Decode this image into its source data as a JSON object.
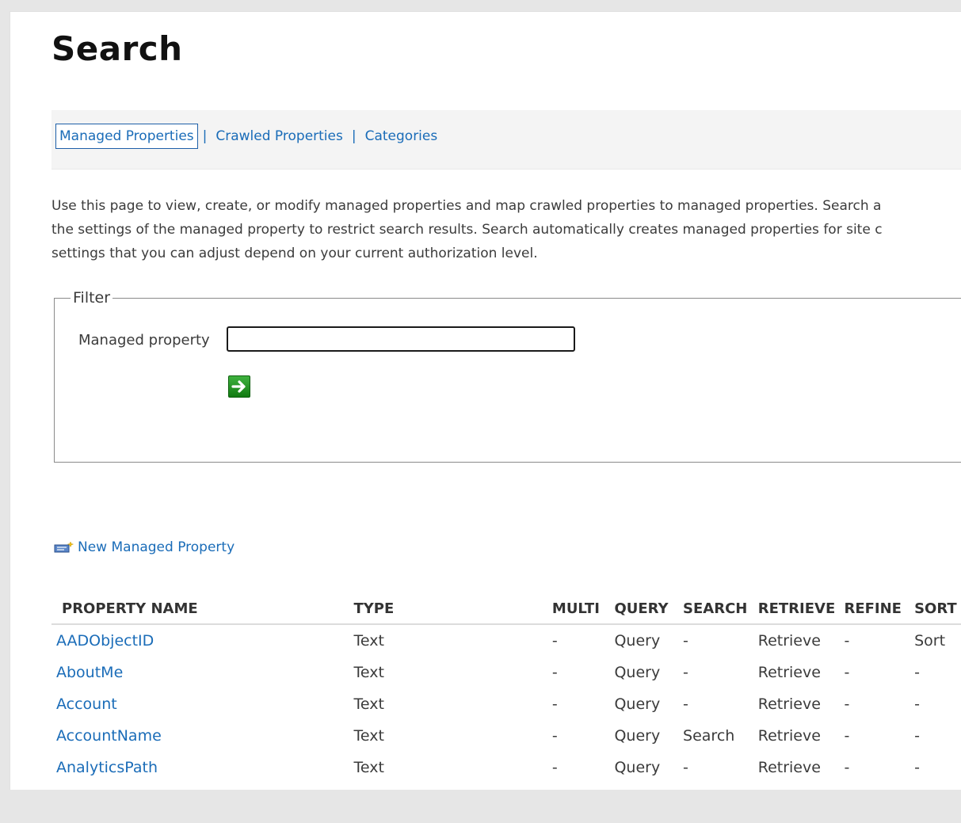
{
  "page": {
    "title": "Search"
  },
  "nav": {
    "links": [
      {
        "label": "Managed Properties",
        "active": true
      },
      {
        "label": "Crawled Properties",
        "active": false
      },
      {
        "label": "Categories",
        "active": false
      }
    ],
    "separator": "|"
  },
  "description": {
    "line1": "Use this page to view, create, or modify managed properties and map crawled properties to managed properties. Search a",
    "line2": "the settings of the managed property to restrict search results. Search automatically creates managed properties for site c",
    "line3": "settings that you can adjust depend on your current authorization level."
  },
  "filter": {
    "legend": "Filter",
    "label": "Managed property",
    "input_value": "",
    "go_icon": "arrow-right-icon"
  },
  "new_property": {
    "label": "New Managed Property",
    "icon": "new-property-icon"
  },
  "table": {
    "columns": [
      "PROPERTY NAME",
      "TYPE",
      "MULTI",
      "QUERY",
      "SEARCH",
      "RETRIEVE",
      "REFINE",
      "SORT"
    ],
    "rows": [
      {
        "name": "AADObjectID",
        "type": "Text",
        "multi": "-",
        "query": "Query",
        "search": "-",
        "retrieve": "Retrieve",
        "refine": "-",
        "sort": "Sort"
      },
      {
        "name": "AboutMe",
        "type": "Text",
        "multi": "-",
        "query": "Query",
        "search": "-",
        "retrieve": "Retrieve",
        "refine": "-",
        "sort": "-"
      },
      {
        "name": "Account",
        "type": "Text",
        "multi": "-",
        "query": "Query",
        "search": "-",
        "retrieve": "Retrieve",
        "refine": "-",
        "sort": "-"
      },
      {
        "name": "AccountName",
        "type": "Text",
        "multi": "-",
        "query": "Query",
        "search": "Search",
        "retrieve": "Retrieve",
        "refine": "-",
        "sort": "-"
      },
      {
        "name": "AnalyticsPath",
        "type": "Text",
        "multi": "-",
        "query": "Query",
        "search": "-",
        "retrieve": "Retrieve",
        "refine": "-",
        "sort": "-"
      }
    ]
  },
  "colors": {
    "link": "#1a6cb8",
    "go_button": "#1f9a1f"
  }
}
